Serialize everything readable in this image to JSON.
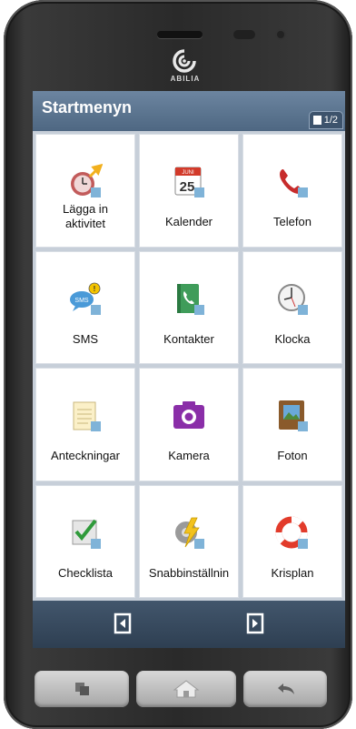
{
  "device": {
    "brand": "ABILIA"
  },
  "header": {
    "title": "Startmenyn",
    "page_indicator": "1/2"
  },
  "tiles": [
    {
      "label": "Lägga in aktivitet",
      "icon": "add-activity-icon"
    },
    {
      "label": "Kalender",
      "icon": "calendar-icon",
      "calendar_month": "JUNI",
      "calendar_day": "25"
    },
    {
      "label": "Telefon",
      "icon": "phone-icon"
    },
    {
      "label": "SMS",
      "icon": "sms-icon"
    },
    {
      "label": "Kontakter",
      "icon": "contacts-icon"
    },
    {
      "label": "Klocka",
      "icon": "clock-icon"
    },
    {
      "label": "Anteckningar",
      "icon": "notes-icon"
    },
    {
      "label": "Kamera",
      "icon": "camera-icon"
    },
    {
      "label": "Foton",
      "icon": "photos-icon"
    },
    {
      "label": "Checklista",
      "icon": "checklist-icon"
    },
    {
      "label": "Snabbinställnin",
      "icon": "quick-settings-icon"
    },
    {
      "label": "Krisplan",
      "icon": "lifebuoy-icon"
    }
  ],
  "nav": {
    "prev_icon": "page-back-icon",
    "next_icon": "page-forward-icon"
  },
  "hardware_keys": [
    {
      "icon": "recent-apps-icon"
    },
    {
      "icon": "home-icon"
    },
    {
      "icon": "back-icon"
    }
  ],
  "colors": {
    "titlebar": "#5a7390",
    "navbar": "#37495d",
    "tile_bg": "#ffffff",
    "grid_lines": "#c7cfd9"
  }
}
